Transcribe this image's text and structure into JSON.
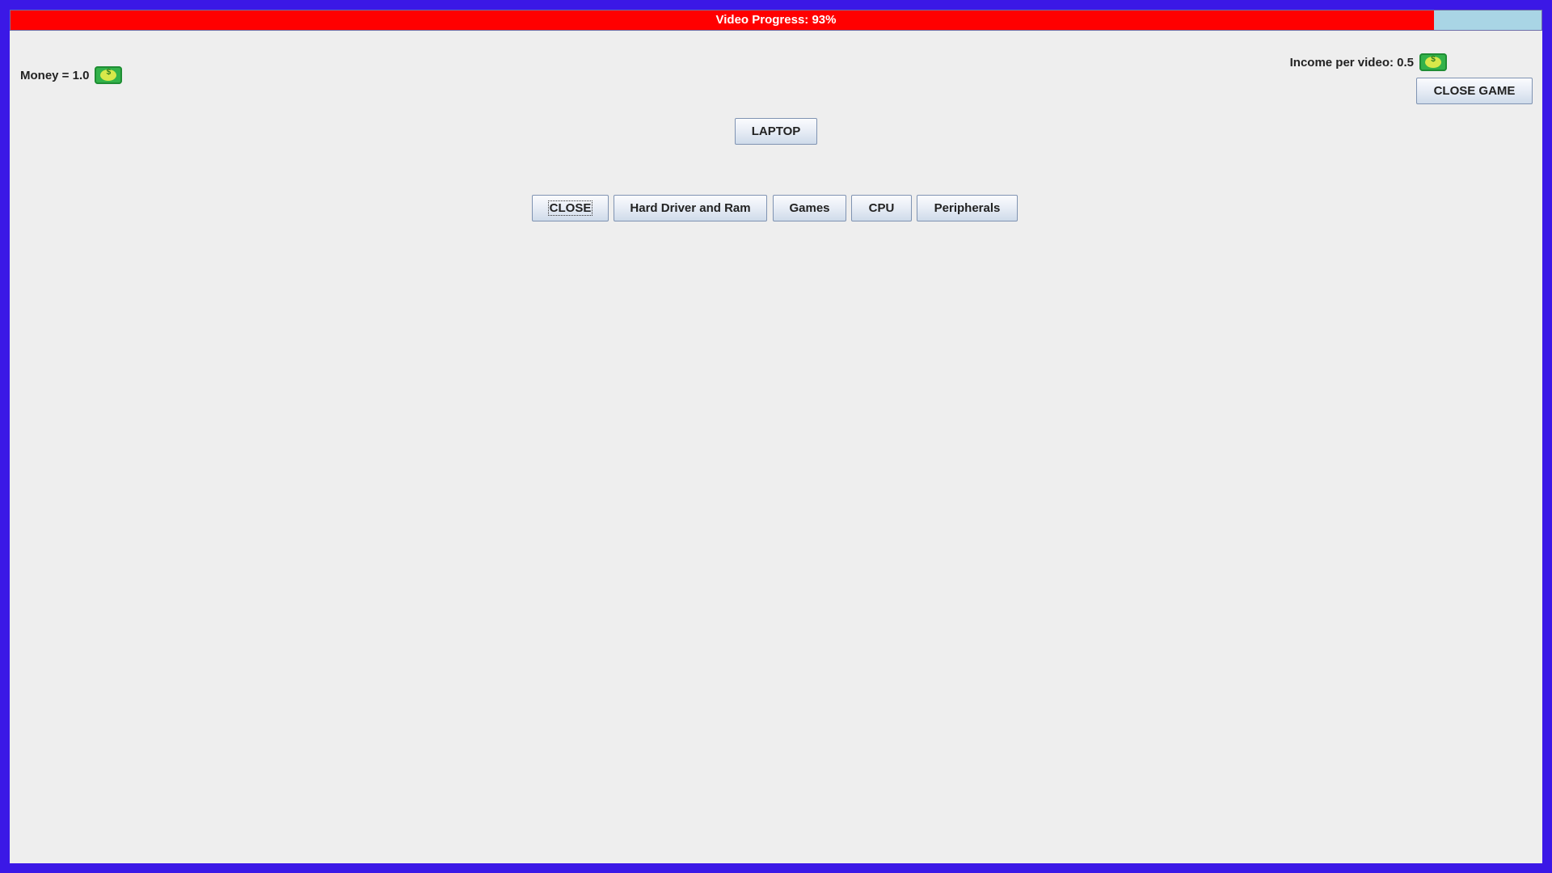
{
  "progress": {
    "label": "Video Progress: 93%",
    "value": 0.93,
    "fill_color": "#ff0000",
    "track_color": "#a9d5e5"
  },
  "money": {
    "label": "Money = 1.0",
    "icon": "cash-icon"
  },
  "income": {
    "label": "Income per video: 0.5",
    "icon": "cash-icon"
  },
  "buttons": {
    "close_game": "CLOSE GAME",
    "laptop": "LAPTOP"
  },
  "menu": {
    "items": [
      {
        "label": "CLOSE"
      },
      {
        "label": "Hard Driver and Ram"
      },
      {
        "label": "Games"
      },
      {
        "label": "CPU"
      },
      {
        "label": "Peripherals"
      }
    ]
  },
  "colors": {
    "window_border": "#3b18e6",
    "background": "#eeeeee"
  }
}
